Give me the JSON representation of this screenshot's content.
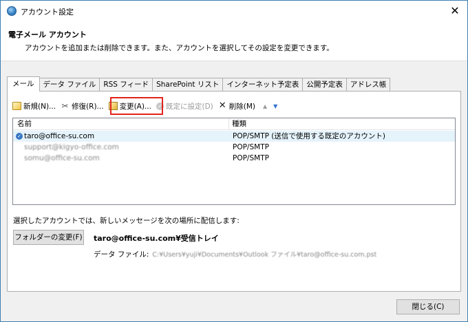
{
  "window": {
    "title": "アカウント設定",
    "close_glyph": "✕"
  },
  "header": {
    "title": "電子メール アカウント",
    "description": "アカウントを追加または削除できます。また、アカウントを選択してその設定を変更できます。"
  },
  "tabs": [
    {
      "label": "メール",
      "active": true
    },
    {
      "label": "データ ファイル"
    },
    {
      "label": "RSS フィード"
    },
    {
      "label": "SharePoint リスト"
    },
    {
      "label": "インターネット予定表"
    },
    {
      "label": "公開予定表"
    },
    {
      "label": "アドレス帳"
    }
  ],
  "toolbar": {
    "new_label": "新規(N)...",
    "repair_label": "修復(R)...",
    "change_label": "変更(A)...",
    "set_default_label": "既定に設定(D)",
    "delete_label": "削除(M)",
    "move_up_glyph": "▲",
    "move_down_glyph": "▼",
    "icons": {
      "new": "new-mail-icon",
      "repair": "tools-icon",
      "change": "edit-account-icon",
      "set_default": "checkmark-circle-icon",
      "delete": "x-icon"
    }
  },
  "list": {
    "columns": {
      "name": "名前",
      "type": "種類"
    },
    "rows": [
      {
        "name": "taro@office-su.com",
        "type": "POP/SMTP (送信で使用する既定のアカウント)",
        "default": true
      },
      {
        "name": "support@kigyo-office.com",
        "type": "POP/SMTP"
      },
      {
        "name": "somu@office-su.com",
        "type": "POP/SMTP"
      }
    ]
  },
  "delivery": {
    "label": "選択したアカウントでは、新しいメッセージを次の場所に配信します:",
    "change_folder_label": "フォルダーの変更(F)",
    "target": "taro@office-su.com¥受信トレイ",
    "data_file_label": "データ ファイル:",
    "data_file_path": "C:¥Users¥yuji¥Documents¥Outlook ファイル¥taro@office-su.com.pst"
  },
  "footer": {
    "close_label": "閉じる(C)"
  },
  "colors": {
    "highlight_box": "#e2231a",
    "selected_row": "#e5f3fb",
    "window_border": "#3c7fb1"
  }
}
